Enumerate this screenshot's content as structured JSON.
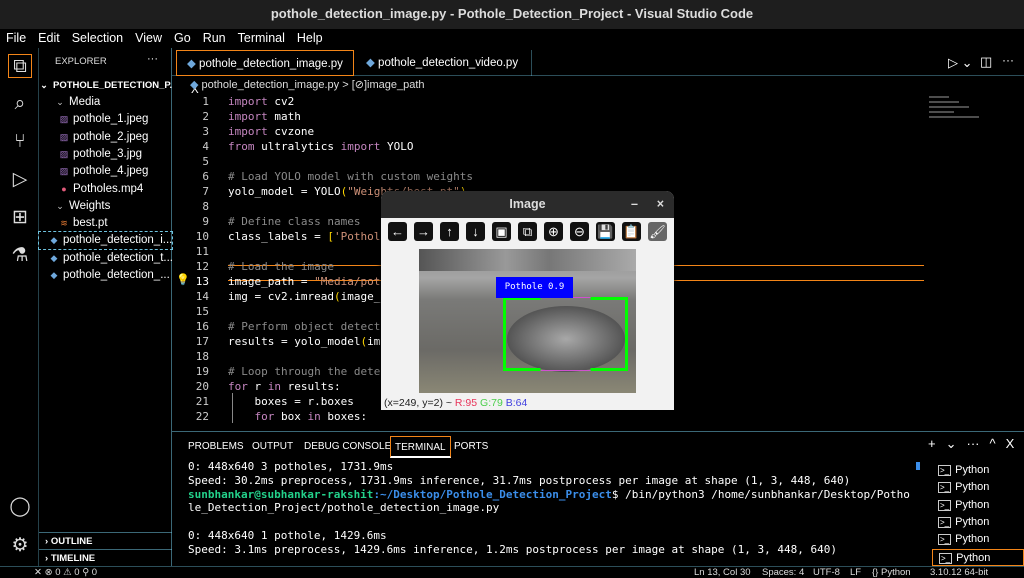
{
  "window": {
    "title": "pothole_detection_image.py - Pothole_Detection_Project - Visual Studio Code"
  },
  "menu": [
    "File",
    "Edit",
    "Selection",
    "View",
    "Go",
    "Run",
    "Terminal",
    "Help"
  ],
  "activity": [
    "files-icon",
    "search-icon",
    "source-control-icon",
    "run-debug-icon",
    "extensions-icon",
    "testing-icon",
    "account-icon",
    "settings-gear-icon"
  ],
  "explorer": {
    "title": "EXPLORER",
    "more": "···",
    "project": "POTHOLE_DETECTION_P...",
    "items": [
      {
        "label": "Media",
        "type": "folder",
        "depth": 1
      },
      {
        "label": "pothole_1.jpeg",
        "type": "image",
        "depth": 2
      },
      {
        "label": "pothole_2.jpeg",
        "type": "image",
        "depth": 2
      },
      {
        "label": "pothole_3.jpg",
        "type": "image",
        "depth": 2
      },
      {
        "label": "pothole_4.jpeg",
        "type": "image",
        "depth": 2
      },
      {
        "label": "Potholes.mp4",
        "type": "video",
        "depth": 2
      },
      {
        "label": "Weights",
        "type": "folder",
        "depth": 1
      },
      {
        "label": "best.pt",
        "type": "rss",
        "depth": 2
      },
      {
        "label": "pothole_detection_i...",
        "type": "python",
        "depth": 1
      },
      {
        "label": "pothole_detection_t...",
        "type": "python",
        "depth": 1
      },
      {
        "label": "pothole_detection_...",
        "type": "python",
        "depth": 1
      }
    ],
    "outline": "OUTLINE",
    "timeline": "TIMELINE"
  },
  "tabs": [
    {
      "label": "pothole_detection_image.py",
      "active": true,
      "close": "X"
    },
    {
      "label": "pothole_detection_video.py",
      "active": false
    }
  ],
  "breadcrumb": {
    "file": "pothole_detection_image.py",
    "sep": ">",
    "symbol": "image_path"
  },
  "code": [
    [
      [
        "kw",
        "import"
      ],
      [
        "",
        "cv2"
      ]
    ],
    [
      [
        "kw",
        "import"
      ],
      [
        "",
        "math"
      ]
    ],
    [
      [
        "kw",
        "import"
      ],
      [
        "",
        "cvzone"
      ]
    ],
    [
      [
        "kw",
        "from"
      ],
      [
        "",
        " ultralytics "
      ],
      [
        "kw",
        "import"
      ],
      [
        "",
        " YOLO"
      ]
    ],
    [],
    [
      [
        "cm",
        "# Load YOLO model with custom weights"
      ]
    ],
    [
      [
        "",
        "yolo_model = YOLO"
      ],
      [
        "pn",
        "("
      ],
      [
        "st",
        "\"Weights/best.pt\""
      ],
      [
        "pn",
        ")"
      ]
    ],
    [],
    [
      [
        "cm",
        "# Define class names"
      ]
    ],
    [
      [
        "",
        "class_labels = "
      ],
      [
        "pn",
        "["
      ],
      [
        "st",
        "'Pothol"
      ]
    ],
    [],
    [
      [
        "cm",
        "# Load the image"
      ]
    ],
    [
      [
        "",
        "image_path = "
      ],
      [
        "st",
        "\"Media/pot"
      ]
    ],
    [
      [
        "",
        "img = cv2.imread"
      ],
      [
        "pn",
        "("
      ],
      [
        "",
        "image_"
      ]
    ],
    [],
    [
      [
        "cm",
        "# Perform object detect"
      ]
    ],
    [
      [
        "",
        "results = yolo_model"
      ],
      [
        "pn",
        "("
      ],
      [
        "",
        "im"
      ]
    ],
    [],
    [
      [
        "cm",
        "# Loop through the dete"
      ]
    ],
    [
      [
        "kw",
        "for"
      ],
      [
        "",
        " r "
      ],
      [
        "kw",
        "in"
      ],
      [
        "",
        " results:"
      ]
    ],
    [
      [
        "",
        "    boxes = r.boxes"
      ]
    ],
    [
      [
        "",
        "    "
      ],
      [
        "kw",
        "for"
      ],
      [
        "",
        " box "
      ],
      [
        "kw",
        "in"
      ],
      [
        "",
        " boxes:"
      ]
    ]
  ],
  "image_window": {
    "title": "Image",
    "min": "–",
    "close": "×",
    "toolbar": [
      "←",
      "→",
      "↑",
      "↓",
      "▣",
      "⧉",
      "⊕",
      "⊖",
      "💾",
      "📋",
      "🖌"
    ],
    "label": "Pothole 0.9",
    "coords": "(x=249, y=2) ~ ",
    "r": "R:95",
    "g": "G:79",
    "b": "B:64"
  },
  "panel": {
    "tabs": [
      "PROBLEMS",
      "OUTPUT",
      "DEBUG CONSOLE",
      "TERMINAL",
      "PORTS"
    ],
    "active": "TERMINAL",
    "actions": [
      "+",
      "⌄",
      "···",
      "^",
      "X"
    ],
    "terminal": [
      {
        "text": "0: 448x640 3 potholes, 1731.9ms"
      },
      {
        "text": "Speed: 30.2ms preprocess, 1731.9ms inference, 31.7ms postprocess per image at shape (1, 3, 448, 640)"
      },
      {
        "user": "sunbhankar@subhankar-rakshit",
        "path": ":~/Desktop/Pothole_Detection_Project",
        "text": "$ /bin/python3 /home/sunbhankar/Desktop/Potho"
      },
      {
        "text": "le_Detection_Project/pothole_detection_image.py"
      },
      {
        "text": ""
      },
      {
        "text": "0: 448x640 1 pothole, 1429.6ms"
      },
      {
        "text": "Speed: 3.1ms preprocess, 1429.6ms inference, 1.2ms postprocess per image at shape (1, 3, 448, 640)"
      }
    ],
    "terminals": [
      "Python",
      "Python",
      "Python",
      "Python",
      "Python",
      "Python"
    ]
  },
  "statusbar": {
    "left": "✕   ⊗ 0 ⚠ 0   ⚲ 0",
    "position": "Ln 13, Col 30",
    "spaces": "Spaces: 4",
    "encoding": "UTF-8",
    "eol": "LF",
    "language": "{} Python",
    "interpreter": "3.10.12 64-bit"
  },
  "colors": {
    "accent_border": "#6fc3df",
    "active_tab_border": "#f38518",
    "keyword": "#c586c0",
    "string": "#ce9178",
    "comment": "#8a8a8a",
    "user": "#23d18b",
    "path": "#3b8eea",
    "box": "#00ff00",
    "label_bg": "#0000ff"
  }
}
